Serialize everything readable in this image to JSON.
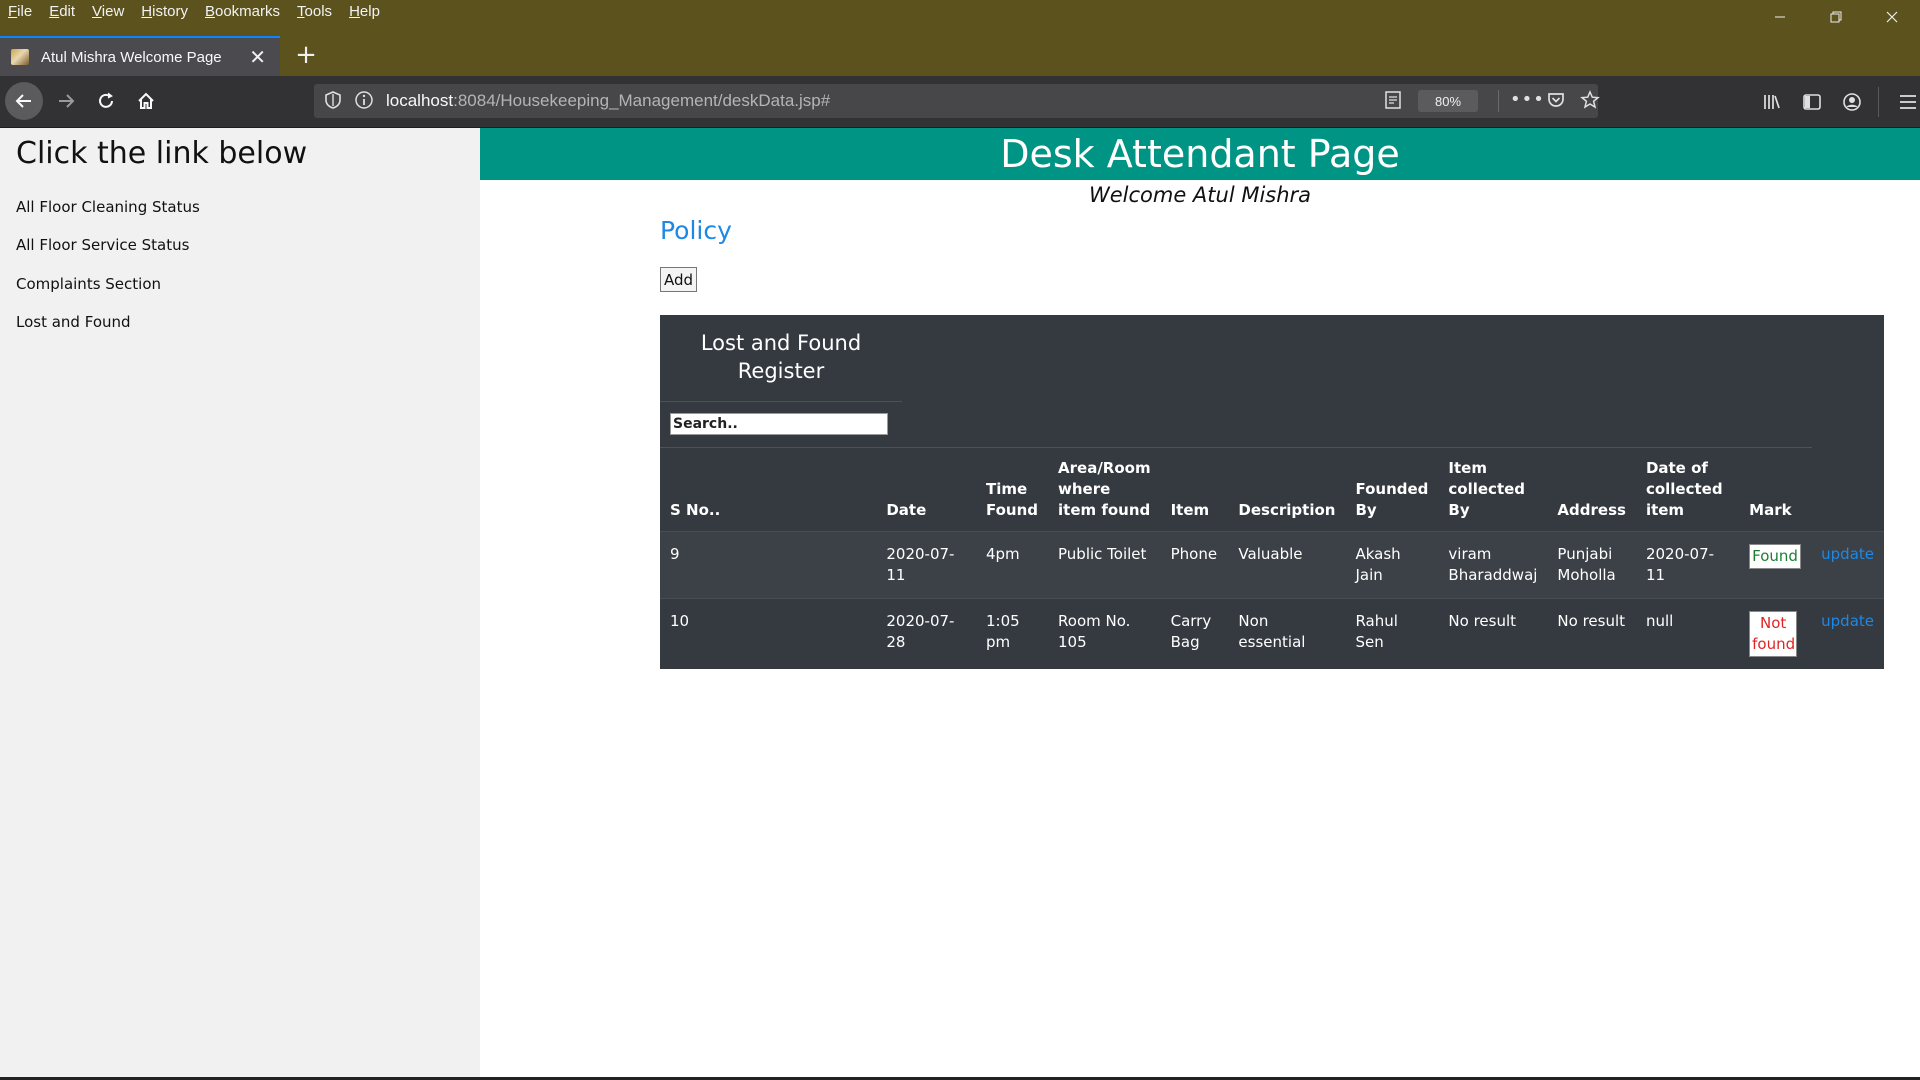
{
  "browser": {
    "menu": [
      "File",
      "Edit",
      "View",
      "History",
      "Bookmarks",
      "Tools",
      "Help"
    ],
    "tab_title": "Atul Mishra Welcome Page",
    "url_host": "localhost",
    "url_rest": ":8084/Housekeeping_Management/deskData.jsp#",
    "zoom": "80%"
  },
  "sidebar": {
    "heading": "Click the link below",
    "links": [
      "All Floor Cleaning Status",
      "All Floor Service Status",
      "Complaints Section",
      "Lost and Found"
    ]
  },
  "header": {
    "title": "Desk Attendant Page",
    "welcome": "Welcome Atul Mishra"
  },
  "main": {
    "policy_link": "Policy",
    "add_button": "Add"
  },
  "register": {
    "title": "Lost and Found Register",
    "search_placeholder": "Search..",
    "columns": [
      "S No..",
      "Date",
      "Time Found",
      "Area/Room where item found",
      "Item",
      "Description",
      "Founded By",
      "Item collected By",
      "Address",
      "Date of collected item",
      "Mark"
    ],
    "rows": [
      {
        "sno": "9",
        "date": "2020-07-11",
        "time": "4pm",
        "area": "Public Toilet",
        "item": "Phone",
        "description": "Valuable",
        "founded_by": "Akash Jain",
        "collected_by": "viram Bharaddwaj",
        "address": "Punjabi Moholla",
        "collected_date": "2020-07-11",
        "mark": "Found",
        "action": "update"
      },
      {
        "sno": "10",
        "date": "2020-07-28",
        "time": "1:05 pm",
        "area": "Room No. 105",
        "item": "Carry Bag",
        "description": "Non essential",
        "founded_by": "Rahul Sen",
        "collected_by": "No result",
        "address": "No result",
        "collected_date": "null",
        "mark": "Not found",
        "action": "update"
      }
    ]
  },
  "colors": {
    "header_band": "#009485",
    "table_bg": "#343a40",
    "link_blue": "#1e88e5",
    "found_green": "#1e7e34",
    "notfound_red": "#e02424"
  }
}
